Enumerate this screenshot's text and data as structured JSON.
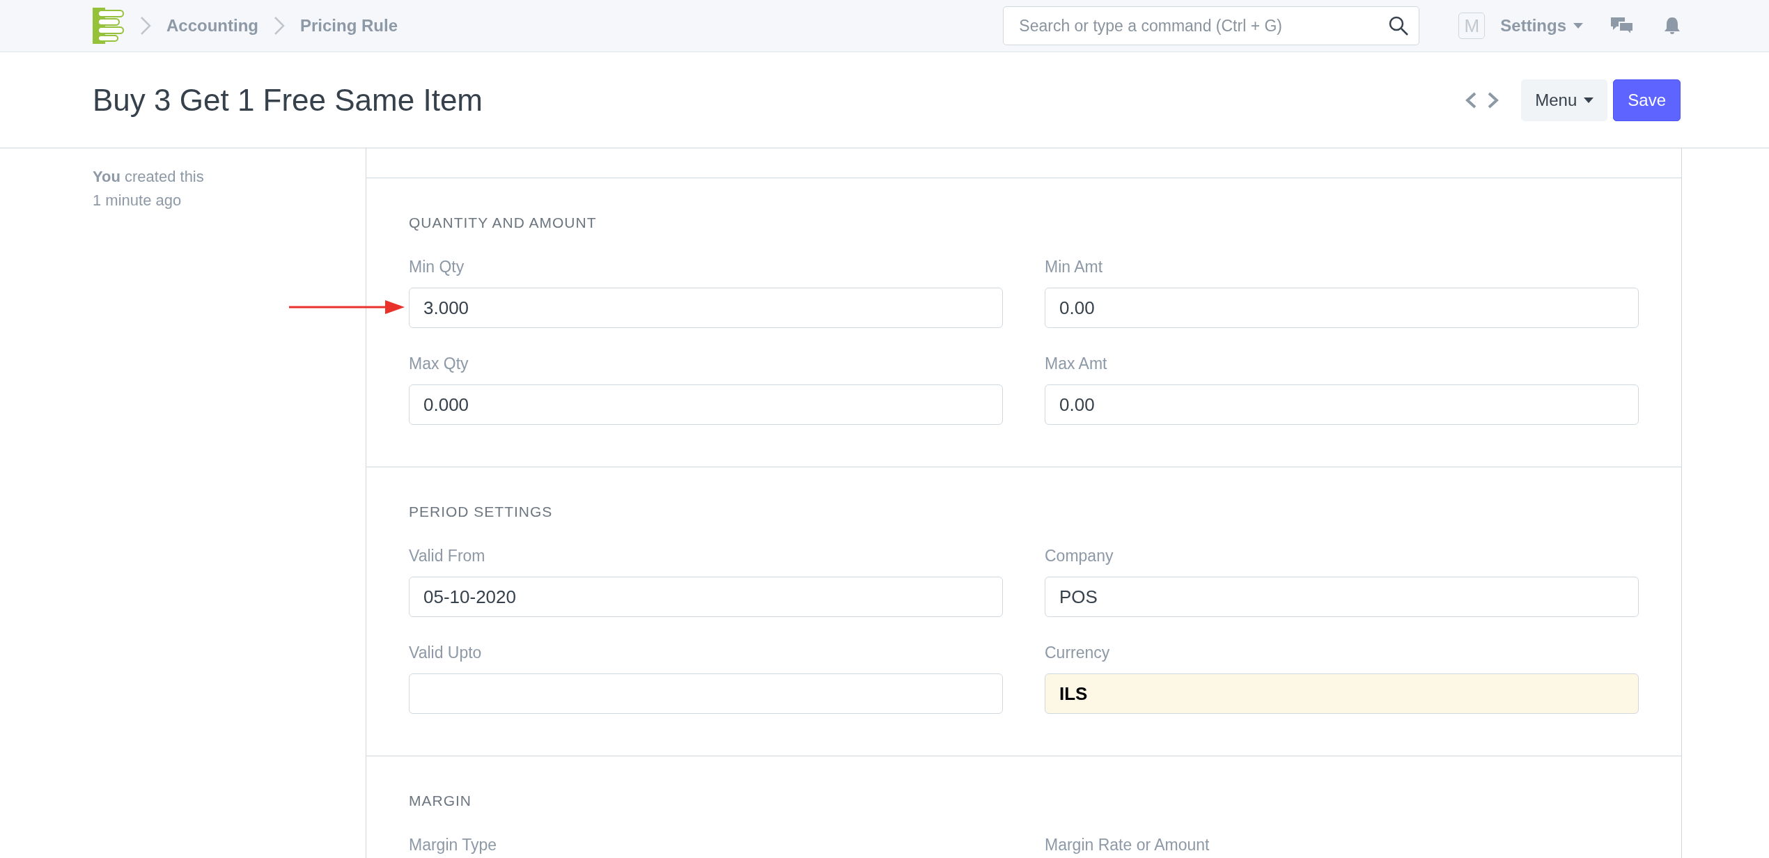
{
  "navbar": {
    "breadcrumbs": [
      "Accounting",
      "Pricing Rule"
    ],
    "search": {
      "placeholder": "Search or type a command (Ctrl + G)"
    },
    "avatar": "M",
    "settings": "Settings"
  },
  "page": {
    "title": "Buy 3 Get 1 Free Same Item",
    "menu_button": "Menu",
    "save_button": "Save"
  },
  "sidebar": {
    "actor": "You",
    "activity": "created this",
    "time": "1 minute ago"
  },
  "sections": [
    {
      "title": "QUANTITY AND AMOUNT",
      "fields": [
        {
          "label": "Min Qty",
          "value": "3.000",
          "read_only": false,
          "arrow": true
        },
        {
          "label": "Min Amt",
          "value": "0.00",
          "read_only": false,
          "arrow": false
        },
        {
          "label": "Max Qty",
          "value": "0.000",
          "read_only": false,
          "arrow": false
        },
        {
          "label": "Max Amt",
          "value": "0.00",
          "read_only": false,
          "arrow": false
        }
      ]
    },
    {
      "title": "PERIOD SETTINGS",
      "fields": [
        {
          "label": "Valid From",
          "value": "05-10-2020",
          "read_only": false,
          "arrow": false
        },
        {
          "label": "Company",
          "value": "POS",
          "read_only": false,
          "arrow": false
        },
        {
          "label": "Valid Upto",
          "read_only": false,
          "arrow": false
        },
        {
          "label": "Currency",
          "value": "ILS",
          "read_only": true,
          "arrow": false
        }
      ]
    },
    {
      "title": "MARGIN",
      "fields": [
        {
          "label": "Margin Type"
        },
        {
          "label": "Margin Rate or Amount"
        }
      ]
    }
  ]
}
